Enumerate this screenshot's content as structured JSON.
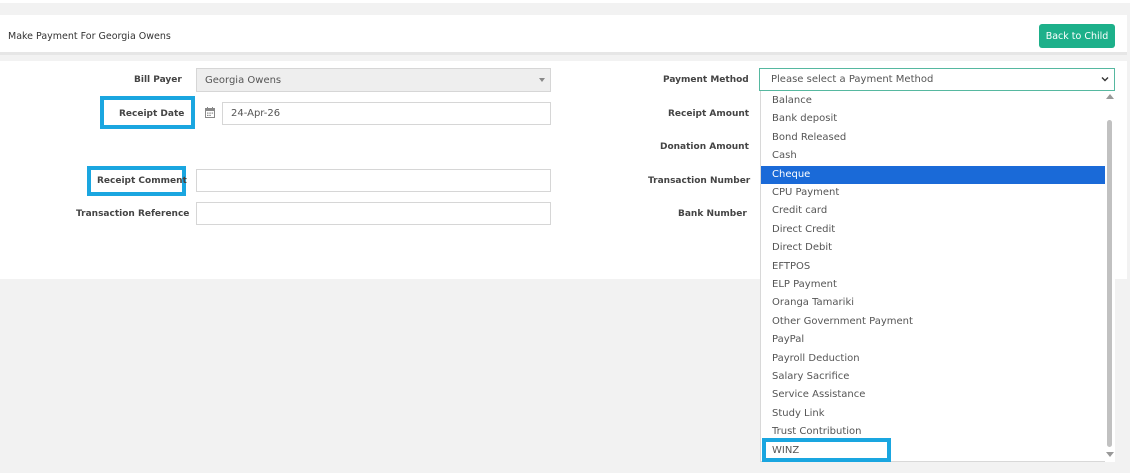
{
  "header": {
    "title": "Make Payment For Georgia Owens",
    "back_button": "Back to Child"
  },
  "form": {
    "bill_payer": {
      "label": "Bill Payer",
      "value": "Georgia Owens"
    },
    "receipt_date": {
      "label": "Receipt Date",
      "value": "24-Apr-26"
    },
    "receipt_comment": {
      "label": "Receipt Comment",
      "value": ""
    },
    "transaction_reference": {
      "label": "Transaction Reference",
      "value": ""
    },
    "payment_method": {
      "label": "Payment Method",
      "placeholder": "Please select a Payment Method"
    },
    "receipt_amount": {
      "label": "Receipt Amount"
    },
    "donation_amount": {
      "label": "Donation Amount"
    },
    "transaction_number": {
      "label": "Transaction Number"
    },
    "bank_number": {
      "label": "Bank Number"
    }
  },
  "dropdown": {
    "options": [
      "Balance",
      "Bank deposit",
      "Bond Released",
      "Cash",
      "Cheque",
      "CPU Payment",
      "Credit card",
      "Direct Credit",
      "Direct Debit",
      "EFTPOS",
      "ELP Payment",
      "Oranga Tamariki",
      "Other Government Payment",
      "PayPal",
      "Payroll Deduction",
      "Salary Sacrifice",
      "Service Assistance",
      "Study Link",
      "Trust Contribution",
      "WINZ"
    ],
    "selected_index": 4,
    "selected_color": "#1a6ad8"
  },
  "colors": {
    "accent_button": "#1db08a",
    "highlight_box": "#1aa6e0"
  },
  "icons": {
    "date": "calendar-icon",
    "select": "chevron-down-icon",
    "bill_payer_select": "caret-down-icon"
  }
}
